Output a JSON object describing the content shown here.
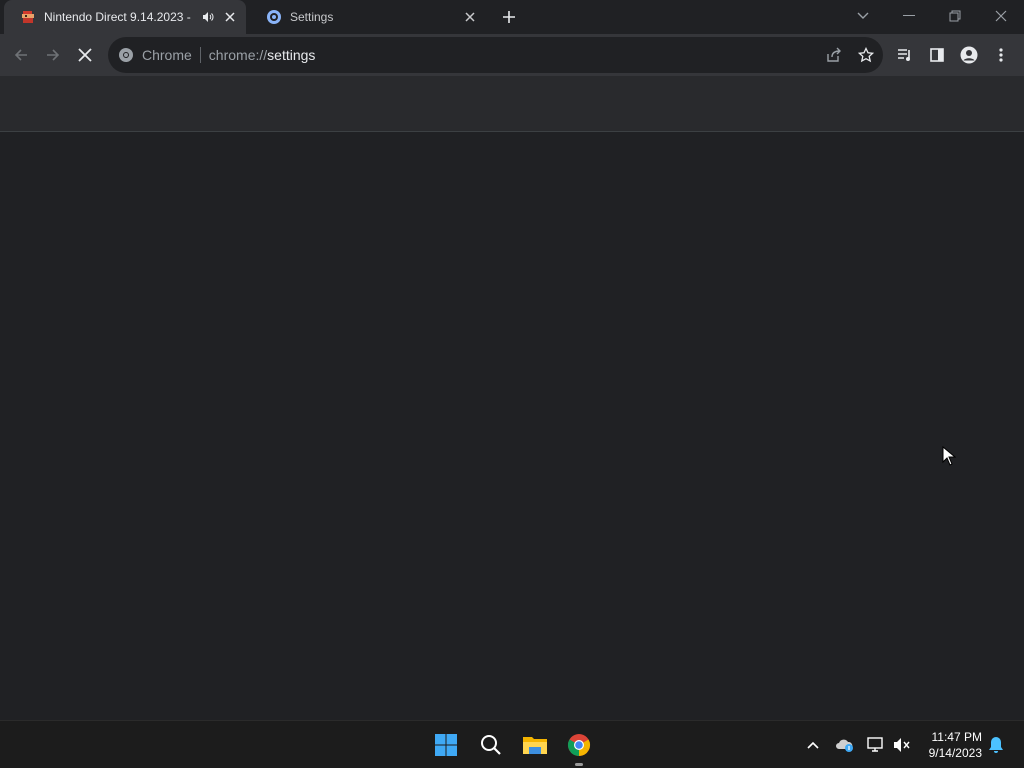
{
  "tabs": [
    {
      "title": "Nintendo Direct 9.14.2023 -",
      "active": true,
      "audio": true
    },
    {
      "title": "Settings",
      "active": false
    }
  ],
  "omnibox": {
    "chip": "Chrome",
    "url_scheme": "chrome://",
    "url_host": "settings"
  },
  "taskbar": {
    "time": "11:47 PM",
    "date": "9/14/2023"
  },
  "colors": {
    "tab_active": "#35363a",
    "frame": "#202124",
    "toolbar": "#35363a",
    "taskbar": "#1c1c1c"
  }
}
